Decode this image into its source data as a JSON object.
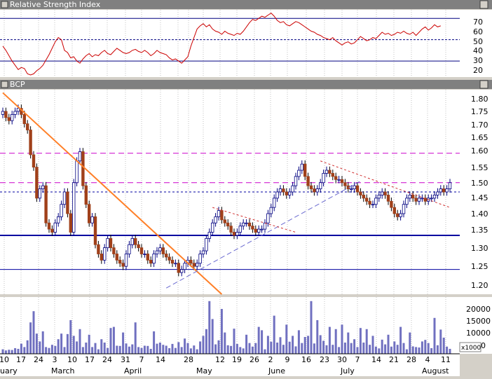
{
  "rsi_panel": {
    "title": "Relative Strength Index",
    "tick_labels": [
      "70",
      "60",
      "50",
      "40",
      "30",
      "20"
    ]
  },
  "price_panel": {
    "title": "BCP",
    "tick_labels": [
      "1.80",
      "1.75",
      "1.70",
      "1.65",
      "1.60",
      "1.55",
      "1.50",
      "1.45",
      "1.40",
      "1.35",
      "1.30",
      "1.25",
      "1.20"
    ]
  },
  "volume_panel": {
    "tick_labels": [
      "20000",
      "15000",
      "10000",
      "5000"
    ],
    "unit_label": "x1000"
  },
  "date_axis": {
    "day_labels": [
      "10",
      "17",
      "24",
      "3",
      "10",
      "17",
      "24",
      "31",
      "7",
      "14",
      "28",
      "12",
      "19",
      "26",
      "2",
      "9",
      "16",
      "23",
      "30",
      "7",
      "14",
      "21",
      "28",
      "4",
      "11"
    ],
    "month_labels": [
      "uary",
      "March",
      "April",
      "May",
      "June",
      "July",
      "August"
    ]
  },
  "colors": {
    "background": "#ffffff",
    "title_bar": "#808080",
    "rsi_line": "#cc0000",
    "rsi_levels": "#000080",
    "candle_up": "#ffffff",
    "candle_down": "#a0401a",
    "candle_up_border": "#000080",
    "trendline_orange": "#ff7f27",
    "support_blue": "#0000a0",
    "resistance_magenta": "#cc00cc",
    "volume_bar": "#7070c0"
  },
  "chart_data": {
    "type": "candlestick",
    "x_axis": "trading days, January to August",
    "rsi": {
      "levels": [
        70,
        50,
        30
      ],
      "range": [
        15,
        78
      ],
      "values": [
        44,
        40,
        35,
        30,
        26,
        22,
        24,
        23,
        18,
        17,
        18,
        21,
        23,
        26,
        31,
        36,
        42,
        48,
        52,
        50,
        40,
        38,
        33,
        34,
        30,
        28,
        32,
        35,
        37,
        34,
        36,
        35,
        38,
        40,
        37,
        36,
        39,
        42,
        40,
        38,
        37,
        38,
        40,
        41,
        39,
        38,
        40,
        38,
        35,
        37,
        40,
        38,
        37,
        36,
        33,
        31,
        32,
        30,
        28,
        31,
        34,
        44,
        52,
        60,
        63,
        65,
        62,
        64,
        60,
        58,
        57,
        55,
        58,
        56,
        55,
        54,
        56,
        55,
        58,
        62,
        66,
        69,
        68,
        70,
        72,
        71,
        73,
        75,
        72,
        68,
        66,
        67,
        64,
        63,
        65,
        67,
        66,
        64,
        62,
        60,
        58,
        57,
        55,
        54,
        52,
        51,
        50,
        52,
        49,
        47,
        45,
        47,
        48,
        46,
        47,
        50,
        53,
        51,
        49,
        50,
        52,
        51,
        54,
        57,
        55,
        56,
        54,
        55,
        57,
        56,
        58,
        56,
        55,
        57,
        54,
        57,
        60,
        62,
        59,
        61,
        64,
        62,
        63
      ]
    },
    "price": {
      "ylim": [
        1.17,
        1.83
      ],
      "horizontal_levels": [
        {
          "value": 1.625,
          "style": "dashed",
          "color": "magenta"
        },
        {
          "value": 1.53,
          "style": "dashed",
          "color": "magenta"
        },
        {
          "value": 1.5,
          "style": "dotted",
          "color": "navy"
        },
        {
          "value": 1.36,
          "style": "solid",
          "color": "navy"
        },
        {
          "value": 1.25,
          "style": "solid",
          "color": "navy"
        }
      ],
      "trendlines": [
        {
          "from_day": 0,
          "from_value": 1.82,
          "to_day": 71,
          "to_value": 1.17,
          "color": "orange"
        },
        {
          "from_day": 53,
          "from_value": 1.19,
          "to_day": 116,
          "to_value": 1.535,
          "color": "slateblue"
        },
        {
          "from_day": 68,
          "from_value": 1.45,
          "to_day": 95,
          "to_value": 1.37,
          "color": "red"
        },
        {
          "from_day": 103,
          "from_value": 1.6,
          "to_day": 145,
          "to_value": 1.45,
          "color": "red"
        }
      ],
      "close": [
        1.76,
        1.74,
        1.73,
        1.75,
        1.76,
        1.77,
        1.75,
        1.72,
        1.7,
        1.62,
        1.58,
        1.48,
        1.51,
        1.52,
        1.4,
        1.38,
        1.37,
        1.4,
        1.42,
        1.46,
        1.5,
        1.43,
        1.37,
        1.53,
        1.6,
        1.63,
        1.52,
        1.46,
        1.4,
        1.42,
        1.33,
        1.3,
        1.28,
        1.32,
        1.35,
        1.32,
        1.3,
        1.28,
        1.27,
        1.26,
        1.3,
        1.33,
        1.35,
        1.33,
        1.32,
        1.3,
        1.3,
        1.28,
        1.27,
        1.3,
        1.31,
        1.32,
        1.3,
        1.29,
        1.28,
        1.27,
        1.27,
        1.24,
        1.25,
        1.27,
        1.28,
        1.27,
        1.26,
        1.27,
        1.3,
        1.31,
        1.35,
        1.37,
        1.4,
        1.42,
        1.44,
        1.41,
        1.4,
        1.39,
        1.37,
        1.36,
        1.37,
        1.39,
        1.4,
        1.4,
        1.39,
        1.38,
        1.37,
        1.38,
        1.38,
        1.4,
        1.43,
        1.45,
        1.48,
        1.5,
        1.51,
        1.5,
        1.49,
        1.5,
        1.52,
        1.55,
        1.57,
        1.59,
        1.55,
        1.52,
        1.51,
        1.5,
        1.51,
        1.53,
        1.56,
        1.57,
        1.56,
        1.55,
        1.54,
        1.54,
        1.53,
        1.52,
        1.51,
        1.51,
        1.52,
        1.5,
        1.49,
        1.48,
        1.47,
        1.46,
        1.46,
        1.48,
        1.49,
        1.5,
        1.49,
        1.47,
        1.45,
        1.43,
        1.42,
        1.43,
        1.46,
        1.48,
        1.49,
        1.48,
        1.47,
        1.48,
        1.48,
        1.47,
        1.48,
        1.48,
        1.49,
        1.5,
        1.51,
        1.5,
        1.51,
        1.53
      ]
    },
    "volume": {
      "ylim": [
        0,
        25000
      ],
      "unit": "x1000",
      "values": [
        2000,
        1500,
        1800,
        1700,
        2500,
        2200,
        4500,
        3000,
        6000,
        14000,
        19000,
        9000,
        5500,
        10000,
        3000,
        2600,
        4000,
        3500,
        6500,
        9000,
        3000,
        8800,
        15000,
        8000,
        5500,
        11000,
        3000,
        5000,
        8500,
        3000,
        4800,
        2000,
        6500,
        5000,
        2600,
        11500,
        12000,
        3600,
        3500,
        9500,
        4600,
        3200,
        4200,
        14000,
        3000,
        2600,
        3600,
        3500,
        2200,
        10000,
        4500,
        5000,
        4000,
        3600,
        2500,
        4400,
        2600,
        5200,
        3000,
        6800,
        4800,
        2400,
        3700,
        2000,
        5500,
        8000,
        11000,
        23500,
        15500,
        4200,
        6000,
        20000,
        9500,
        3800,
        3500,
        11200,
        4400,
        3000,
        2400,
        8500,
        4800,
        3200,
        4800,
        12000,
        10500,
        2000,
        8000,
        5400,
        17000,
        5000,
        7400,
        4000,
        13000,
        5400,
        8000,
        3300,
        10500,
        4800,
        7500,
        8000,
        23500,
        4600,
        15000,
        8300,
        5800,
        3800,
        12000,
        4000,
        11000,
        3000,
        13000,
        5000,
        9500,
        4800,
        6500,
        3000,
        11500,
        5000,
        11000,
        4000,
        8000,
        3200,
        2400,
        6300,
        4200,
        8500,
        3200,
        5500,
        4000,
        12000,
        4800,
        2000,
        9500,
        3300,
        3000,
        2800,
        5500,
        6200,
        4800,
        2500,
        16000,
        3800,
        10800,
        7200,
        3200,
        2200
      ]
    }
  }
}
